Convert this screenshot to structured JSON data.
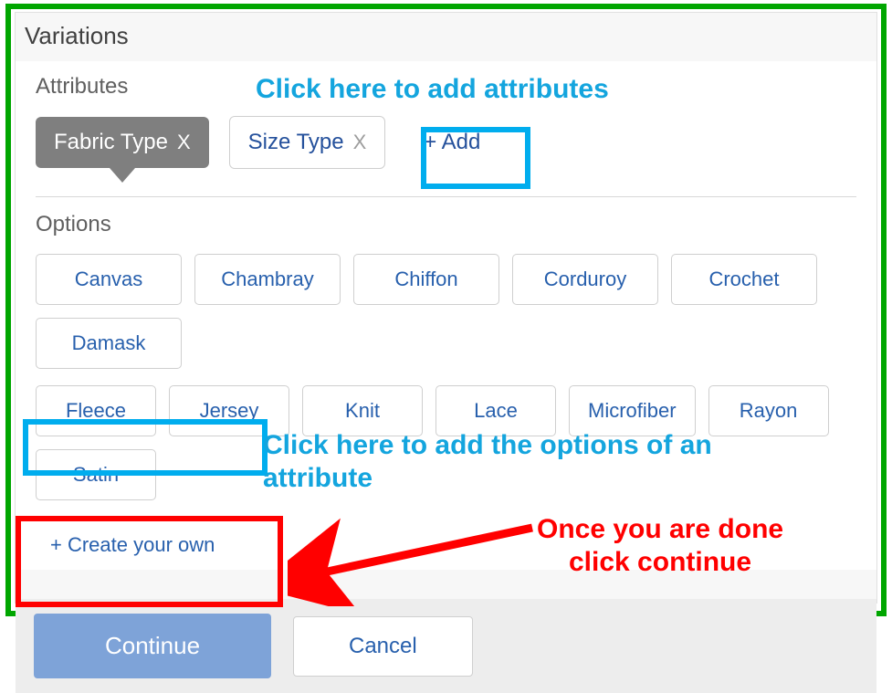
{
  "section_title": "Variations",
  "attributes": {
    "heading": "Attributes",
    "tags": [
      {
        "label": "Fabric Type",
        "active": true
      },
      {
        "label": "Size Type",
        "active": false
      }
    ],
    "add_label": "+ Add",
    "remove_glyph": "X"
  },
  "options": {
    "heading": "Options",
    "row1": [
      "Canvas",
      "Chambray",
      "Chiffon",
      "Corduroy",
      "Crochet",
      "Damask"
    ],
    "row2": [
      "Fleece",
      "Jersey",
      "Knit",
      "Lace",
      "Microfiber",
      "Rayon",
      "Satin"
    ],
    "create_own_label": "+ Create your own"
  },
  "footer": {
    "continue_label": "Continue",
    "cancel_label": "Cancel"
  },
  "annotations": {
    "add_attr_callout": "Click here to add attributes",
    "add_options_callout": "Click here to add the options of an attribute",
    "continue_callout_l1": "Once you are done",
    "continue_callout_l2": "click continue"
  },
  "colors": {
    "frame_green": "#00a600",
    "highlight_blue": "#00adee",
    "highlight_red": "#ff0000",
    "link_blue": "#2860ad",
    "active_tag_grey": "#7f7f7f",
    "continue_blue": "#7ea3d8"
  }
}
